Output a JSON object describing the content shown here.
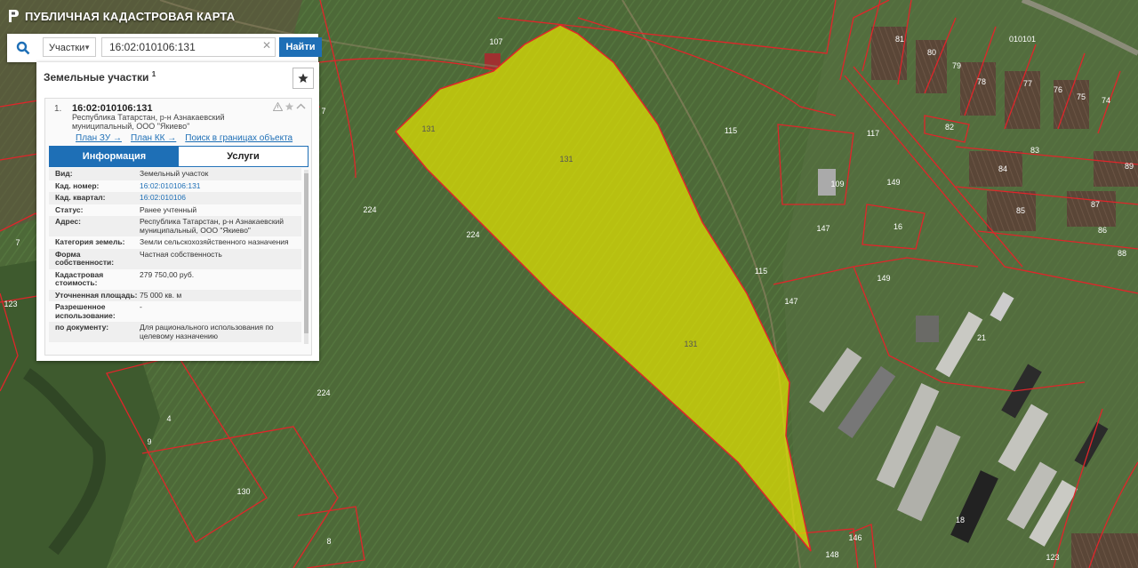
{
  "app": {
    "title": "ПУБЛИЧНАЯ КАДАСТРОВАЯ КАРТА"
  },
  "search": {
    "type": "Участки",
    "query": "16:02:010106:131",
    "button": "Найти"
  },
  "panel": {
    "title": "Земельные участки",
    "title_sup": "1",
    "item_number": "1.",
    "cad_number": "16:02:010106:131",
    "address": "Республика Татарстан, р-н Азнакаевский муниципальный, ООО \"Якиево\"",
    "links": [
      "План ЗУ →",
      "План КК →",
      "Поиск в границах объекта →"
    ],
    "tabs": {
      "info": "Информация",
      "services": "Услуги"
    },
    "rows": [
      {
        "k": "Вид:",
        "v": "Земельный участок"
      },
      {
        "k": "Кад. номер:",
        "v": "16:02:010106:131",
        "link": true
      },
      {
        "k": "Кад. квартал:",
        "v": "16:02:010106",
        "link": true
      },
      {
        "k": "Статус:",
        "v": "Ранее учтенный"
      },
      {
        "k": "Адрес:",
        "v": "Республика Татарстан, р-н Азнакаевский муниципальный, ООО \"Якиево\""
      },
      {
        "k": "Категория земель:",
        "v": "Земли сельскохозяйственного назначения"
      },
      {
        "k": "Форма собственности:",
        "v": "Частная собственность"
      },
      {
        "k": "Кадастровая стоимость:",
        "v": "279 750,00 руб."
      },
      {
        "k": "Уточненная площадь:",
        "v": "75 000 кв. м"
      },
      {
        "k": "Разрешенное использование:",
        "v": "-"
      },
      {
        "k": "по документу:",
        "v": "Для рационального использования по целевому назначению"
      }
    ]
  },
  "map": {
    "parcel_labels": [
      "131",
      "131",
      "131",
      "107",
      "115",
      "115",
      "117",
      "224",
      "224",
      "224",
      "130",
      "4",
      "8",
      "9",
      "7",
      "7",
      "123",
      "147",
      "147",
      "149",
      "149",
      "16",
      "18",
      "21",
      "148",
      "146",
      "81",
      "80",
      "79",
      "78",
      "77",
      "76",
      "75",
      "74",
      "82",
      "84",
      "83",
      "85",
      "87",
      "86",
      "89",
      "88",
      "123",
      "010101",
      "109"
    ],
    "colors": {
      "selected_fill": "#e6e600",
      "boundary": "#e0252a"
    }
  }
}
